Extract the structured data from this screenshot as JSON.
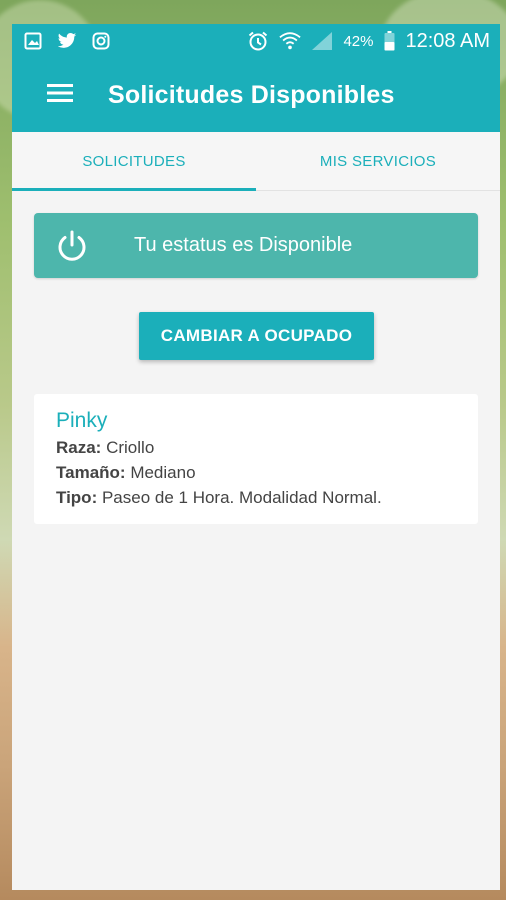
{
  "statusbar": {
    "left_icons": [
      "image-icon",
      "twitter-icon",
      "instagram-icon"
    ],
    "right_icons": [
      "alarm-icon",
      "wifi-icon",
      "signal-icon",
      "battery-icon"
    ],
    "battery": "42%",
    "time": "12:08 AM"
  },
  "appbar": {
    "title": "Solicitudes Disponibles",
    "menu_icon": "menu-icon"
  },
  "tabs": [
    {
      "label": "SOLICITUDES",
      "active": true
    },
    {
      "label": "MIS SERVICIOS",
      "active": false
    }
  ],
  "status_card": {
    "icon": "power-icon",
    "text": "Tu estatus es Disponible"
  },
  "change_button": {
    "label": "CAMBIAR A OCUPADO"
  },
  "request": {
    "name": "Pinky",
    "breed_label": "Raza:",
    "breed": "Criollo",
    "size_label": "Tamaño:",
    "size": "Mediano",
    "type_label": "Tipo:",
    "type": "Paseo de 1 Hora. Modalidad Normal."
  },
  "colors": {
    "primary": "#1bafba",
    "status_card": "#4db6ac",
    "background": "#f4f4f4"
  }
}
